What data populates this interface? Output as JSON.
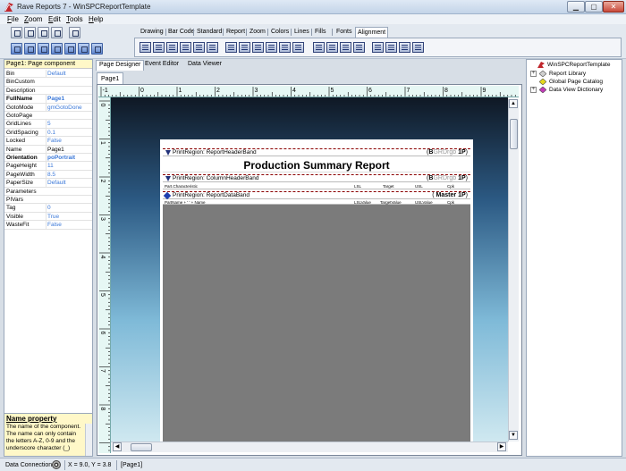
{
  "window": {
    "title": "Rave Reports 7 - WinSPCReportTemplate"
  },
  "menu": [
    "File",
    "Zoom",
    "Edit",
    "Tools",
    "Help"
  ],
  "toolbar_tabs": [
    "Drawing",
    "Bar Code",
    "Standard",
    "Report",
    "Zoom",
    "Colors",
    "Lines",
    "Fills",
    "Fonts",
    "Alignment"
  ],
  "toolbar_tabs_selected": "Alignment",
  "properties": {
    "header": "Page1: Page component",
    "rows": [
      {
        "name": "Bin",
        "value": "Default"
      },
      {
        "name": "BinCustom",
        "value": ""
      },
      {
        "name": "Description",
        "value": ""
      },
      {
        "name": "FullName",
        "value": "Page1",
        "bold": true
      },
      {
        "name": "GotoMode",
        "value": "gmGotoDone"
      },
      {
        "name": "GotoPage",
        "value": ""
      },
      {
        "name": "GridLines",
        "value": "5"
      },
      {
        "name": "GridSpacing",
        "value": "0.1"
      },
      {
        "name": "Locked",
        "value": "False"
      },
      {
        "name": "Name",
        "value": "Page1"
      },
      {
        "name": "Orientation",
        "value": "poPortrait",
        "bold": true
      },
      {
        "name": "PageHeight",
        "value": "11"
      },
      {
        "name": "PageWidth",
        "value": "8.5"
      },
      {
        "name": "PaperSize",
        "value": "Default"
      },
      {
        "name": "Parameters",
        "value": ""
      },
      {
        "name": "PIVars",
        "value": ""
      },
      {
        "name": "Tag",
        "value": "0"
      },
      {
        "name": "Visible",
        "value": "True"
      },
      {
        "name": "WasteFit",
        "value": "False"
      }
    ]
  },
  "help": {
    "title": "Name property",
    "text": "The name of the component. The name can only contain the letters A-Z, 0-9 and the underscore character (_)"
  },
  "designer_tabs": [
    "Page Designer",
    "Event Editor",
    "Data Viewer"
  ],
  "page_tab": "Page1",
  "ruler": {
    "h_labels": [
      "-1",
      "0",
      "1",
      "2",
      "3",
      "4",
      "5",
      "6",
      "7",
      "8",
      "9"
    ],
    "v_labels": [
      "0",
      "1",
      "2",
      "3",
      "4",
      "5",
      "6",
      "7",
      "8"
    ]
  },
  "report": {
    "header_band": "PrintRegion: ReportHeaderBand",
    "header_code": {
      "open": "(",
      "b": "B",
      "rest": "GRDrgb",
      "num": "1",
      "p": "P",
      "close": ")"
    },
    "title": "Production Summary Report",
    "column_band": "PrintRegion: ColumnHeaderBand",
    "column_code": {
      "open": "(",
      "b": "B",
      "rest": "GRDrgb",
      "num": "1",
      "p": "P",
      "close": ")"
    },
    "column_cells": [
      "Part.Characteristic",
      "LSL",
      "Target",
      "USL",
      "Cpk"
    ],
    "data_band": "PrintRegion: ReportDataBand",
    "data_code": {
      "open": "(",
      "b": "Master",
      "num": "1",
      "p": "P",
      "close": ")"
    },
    "data_cells": [
      "PartName + '  ' + Name",
      "LSLValue",
      "TargetValue",
      "USLValue",
      "Cpk"
    ]
  },
  "tree": [
    {
      "label": "WinSPCReportTemplate",
      "expander": ""
    },
    {
      "label": "Report Library",
      "expander": "+"
    },
    {
      "label": "Global Page Catalog",
      "expander": ""
    },
    {
      "label": "Data View Dictionary",
      "expander": "+"
    }
  ],
  "status": {
    "connection": "Data Connection",
    "coords": "X = 9.0, Y = 3.8",
    "page": "[Page1]"
  },
  "colors": {
    "accent_blue": "#3b78d8",
    "band_line": "#8b0000",
    "data_fill": "#7b7b7b"
  }
}
